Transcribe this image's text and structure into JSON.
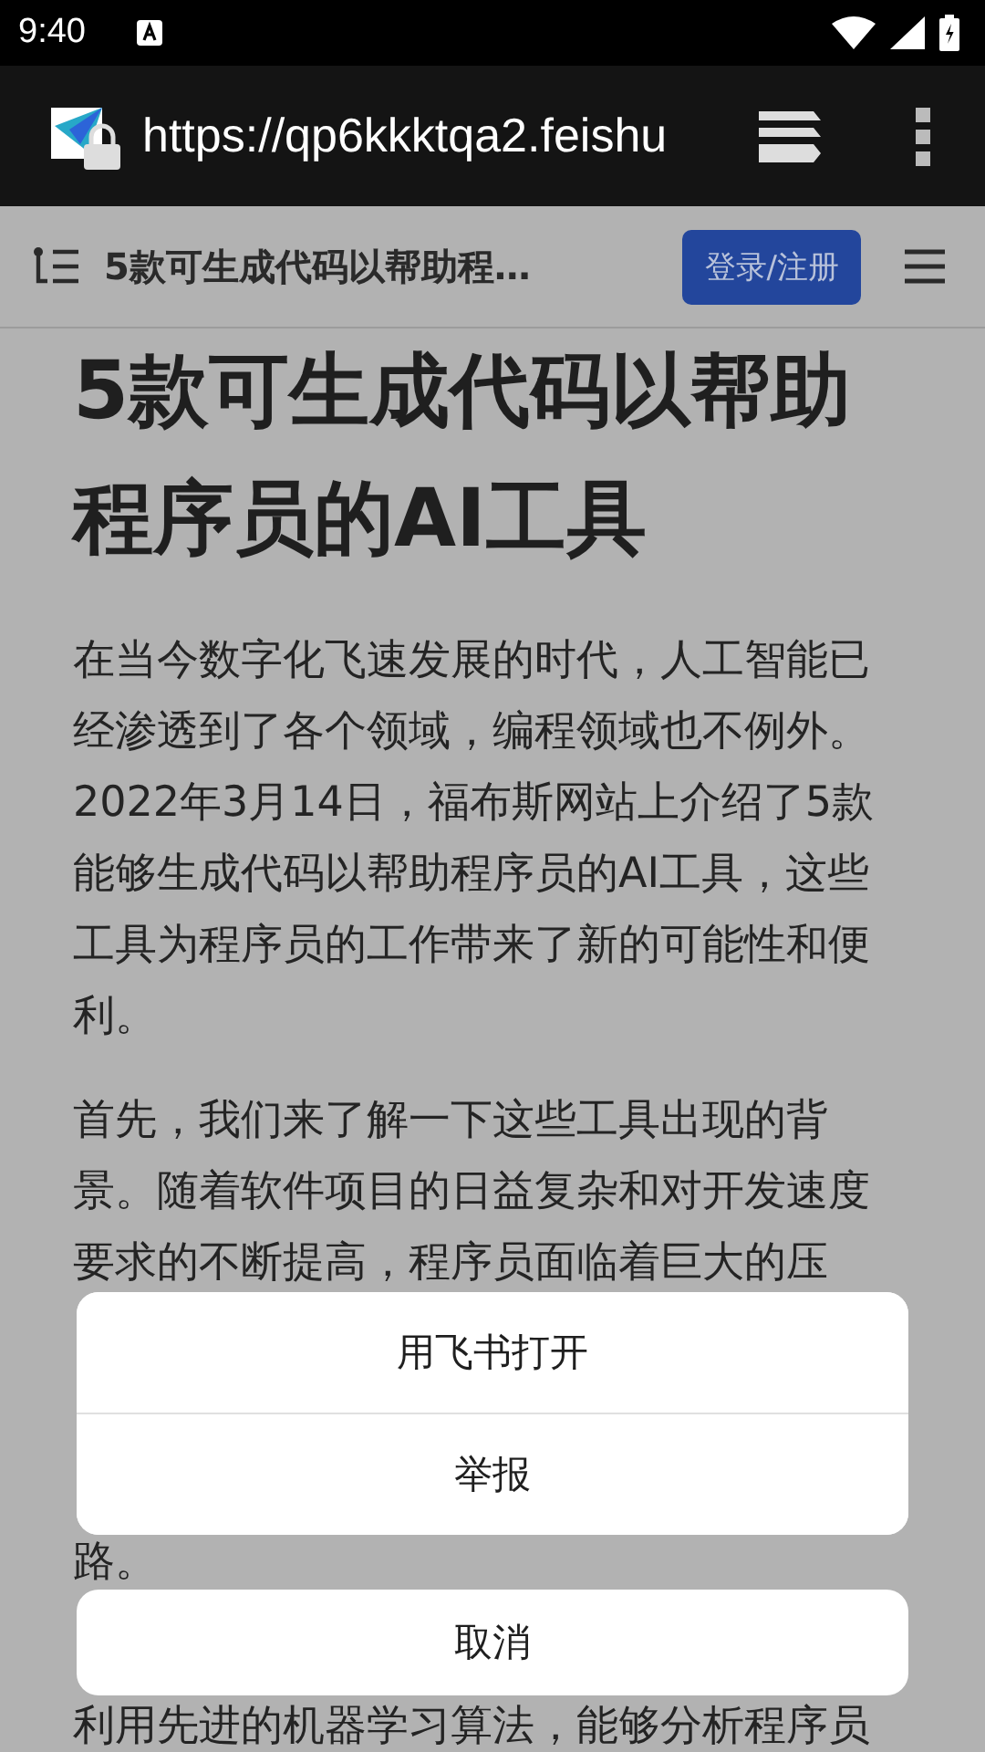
{
  "status_bar": {
    "time": "9:40"
  },
  "browser": {
    "url": "https://qp6kkktqa2.feishu"
  },
  "page_header": {
    "title": "5款可生成代码以帮助程…",
    "login_button": "登录/注册"
  },
  "article": {
    "title": "5款可生成代码以帮助程序员的AI工具",
    "paragraph_1": [
      "在当今数字化飞速发展的时代，人工智能已",
      "经渗透到了各个领域，编程领域也不例外。",
      "2022年3月14日，福布斯网站上介绍了5款",
      "能够生成代码以帮助程序员的AI工具，这些",
      "工具为程序员的工作带来了新的可能性和便",
      "利。"
    ],
    "paragraph_2_visible": [
      "首先，我们来了解一下这些工具出现的背",
      "景。随着软件项目的日益复杂和对开发速度",
      "要求的不断提高，程序员面临着巨大的压"
    ],
    "paragraph_2_end": "路。",
    "paragraph_3_visible": "利用先进的机器学习算法，能够分析程序员"
  },
  "action_sheet": {
    "items": [
      "用飞书打开",
      "举报"
    ],
    "cancel": "取消"
  }
}
